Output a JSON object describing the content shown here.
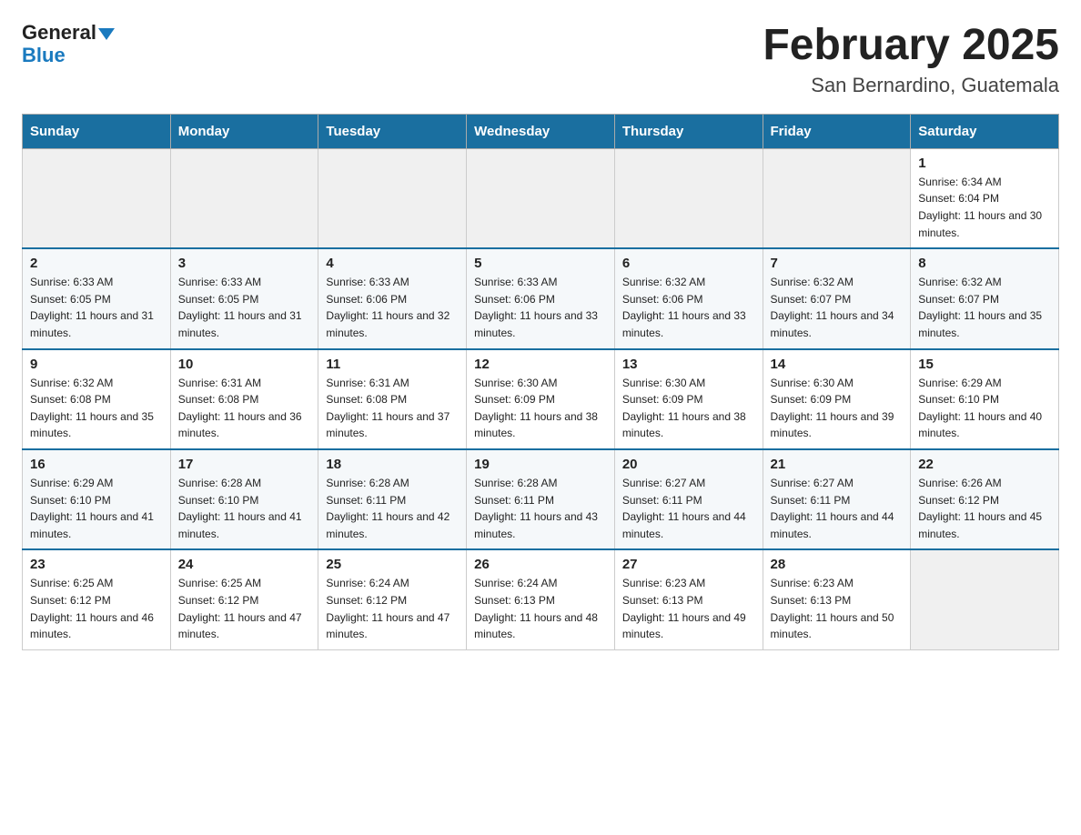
{
  "header": {
    "logo_line1": "General",
    "logo_line2": "Blue",
    "month_title": "February 2025",
    "location": "San Bernardino, Guatemala"
  },
  "days_of_week": [
    "Sunday",
    "Monday",
    "Tuesday",
    "Wednesday",
    "Thursday",
    "Friday",
    "Saturday"
  ],
  "weeks": [
    [
      {
        "day": "",
        "sunrise": "",
        "sunset": "",
        "daylight": ""
      },
      {
        "day": "",
        "sunrise": "",
        "sunset": "",
        "daylight": ""
      },
      {
        "day": "",
        "sunrise": "",
        "sunset": "",
        "daylight": ""
      },
      {
        "day": "",
        "sunrise": "",
        "sunset": "",
        "daylight": ""
      },
      {
        "day": "",
        "sunrise": "",
        "sunset": "",
        "daylight": ""
      },
      {
        "day": "",
        "sunrise": "",
        "sunset": "",
        "daylight": ""
      },
      {
        "day": "1",
        "sunrise": "Sunrise: 6:34 AM",
        "sunset": "Sunset: 6:04 PM",
        "daylight": "Daylight: 11 hours and 30 minutes."
      }
    ],
    [
      {
        "day": "2",
        "sunrise": "Sunrise: 6:33 AM",
        "sunset": "Sunset: 6:05 PM",
        "daylight": "Daylight: 11 hours and 31 minutes."
      },
      {
        "day": "3",
        "sunrise": "Sunrise: 6:33 AM",
        "sunset": "Sunset: 6:05 PM",
        "daylight": "Daylight: 11 hours and 31 minutes."
      },
      {
        "day": "4",
        "sunrise": "Sunrise: 6:33 AM",
        "sunset": "Sunset: 6:06 PM",
        "daylight": "Daylight: 11 hours and 32 minutes."
      },
      {
        "day": "5",
        "sunrise": "Sunrise: 6:33 AM",
        "sunset": "Sunset: 6:06 PM",
        "daylight": "Daylight: 11 hours and 33 minutes."
      },
      {
        "day": "6",
        "sunrise": "Sunrise: 6:32 AM",
        "sunset": "Sunset: 6:06 PM",
        "daylight": "Daylight: 11 hours and 33 minutes."
      },
      {
        "day": "7",
        "sunrise": "Sunrise: 6:32 AM",
        "sunset": "Sunset: 6:07 PM",
        "daylight": "Daylight: 11 hours and 34 minutes."
      },
      {
        "day": "8",
        "sunrise": "Sunrise: 6:32 AM",
        "sunset": "Sunset: 6:07 PM",
        "daylight": "Daylight: 11 hours and 35 minutes."
      }
    ],
    [
      {
        "day": "9",
        "sunrise": "Sunrise: 6:32 AM",
        "sunset": "Sunset: 6:08 PM",
        "daylight": "Daylight: 11 hours and 35 minutes."
      },
      {
        "day": "10",
        "sunrise": "Sunrise: 6:31 AM",
        "sunset": "Sunset: 6:08 PM",
        "daylight": "Daylight: 11 hours and 36 minutes."
      },
      {
        "day": "11",
        "sunrise": "Sunrise: 6:31 AM",
        "sunset": "Sunset: 6:08 PM",
        "daylight": "Daylight: 11 hours and 37 minutes."
      },
      {
        "day": "12",
        "sunrise": "Sunrise: 6:30 AM",
        "sunset": "Sunset: 6:09 PM",
        "daylight": "Daylight: 11 hours and 38 minutes."
      },
      {
        "day": "13",
        "sunrise": "Sunrise: 6:30 AM",
        "sunset": "Sunset: 6:09 PM",
        "daylight": "Daylight: 11 hours and 38 minutes."
      },
      {
        "day": "14",
        "sunrise": "Sunrise: 6:30 AM",
        "sunset": "Sunset: 6:09 PM",
        "daylight": "Daylight: 11 hours and 39 minutes."
      },
      {
        "day": "15",
        "sunrise": "Sunrise: 6:29 AM",
        "sunset": "Sunset: 6:10 PM",
        "daylight": "Daylight: 11 hours and 40 minutes."
      }
    ],
    [
      {
        "day": "16",
        "sunrise": "Sunrise: 6:29 AM",
        "sunset": "Sunset: 6:10 PM",
        "daylight": "Daylight: 11 hours and 41 minutes."
      },
      {
        "day": "17",
        "sunrise": "Sunrise: 6:28 AM",
        "sunset": "Sunset: 6:10 PM",
        "daylight": "Daylight: 11 hours and 41 minutes."
      },
      {
        "day": "18",
        "sunrise": "Sunrise: 6:28 AM",
        "sunset": "Sunset: 6:11 PM",
        "daylight": "Daylight: 11 hours and 42 minutes."
      },
      {
        "day": "19",
        "sunrise": "Sunrise: 6:28 AM",
        "sunset": "Sunset: 6:11 PM",
        "daylight": "Daylight: 11 hours and 43 minutes."
      },
      {
        "day": "20",
        "sunrise": "Sunrise: 6:27 AM",
        "sunset": "Sunset: 6:11 PM",
        "daylight": "Daylight: 11 hours and 44 minutes."
      },
      {
        "day": "21",
        "sunrise": "Sunrise: 6:27 AM",
        "sunset": "Sunset: 6:11 PM",
        "daylight": "Daylight: 11 hours and 44 minutes."
      },
      {
        "day": "22",
        "sunrise": "Sunrise: 6:26 AM",
        "sunset": "Sunset: 6:12 PM",
        "daylight": "Daylight: 11 hours and 45 minutes."
      }
    ],
    [
      {
        "day": "23",
        "sunrise": "Sunrise: 6:25 AM",
        "sunset": "Sunset: 6:12 PM",
        "daylight": "Daylight: 11 hours and 46 minutes."
      },
      {
        "day": "24",
        "sunrise": "Sunrise: 6:25 AM",
        "sunset": "Sunset: 6:12 PM",
        "daylight": "Daylight: 11 hours and 47 minutes."
      },
      {
        "day": "25",
        "sunrise": "Sunrise: 6:24 AM",
        "sunset": "Sunset: 6:12 PM",
        "daylight": "Daylight: 11 hours and 47 minutes."
      },
      {
        "day": "26",
        "sunrise": "Sunrise: 6:24 AM",
        "sunset": "Sunset: 6:13 PM",
        "daylight": "Daylight: 11 hours and 48 minutes."
      },
      {
        "day": "27",
        "sunrise": "Sunrise: 6:23 AM",
        "sunset": "Sunset: 6:13 PM",
        "daylight": "Daylight: 11 hours and 49 minutes."
      },
      {
        "day": "28",
        "sunrise": "Sunrise: 6:23 AM",
        "sunset": "Sunset: 6:13 PM",
        "daylight": "Daylight: 11 hours and 50 minutes."
      },
      {
        "day": "",
        "sunrise": "",
        "sunset": "",
        "daylight": ""
      }
    ]
  ]
}
